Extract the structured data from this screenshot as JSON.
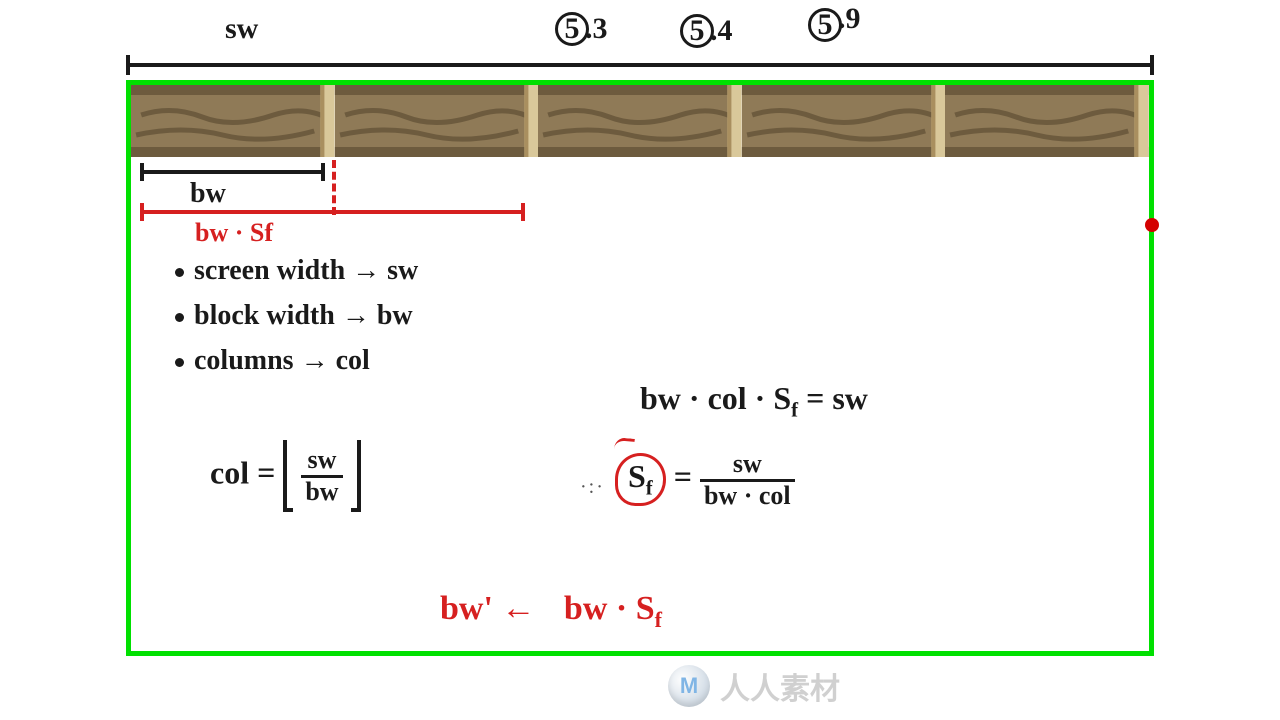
{
  "top": {
    "sw": "sw",
    "v1_prefix": "5",
    "v1_suffix": ".3",
    "v2_prefix": "5",
    "v2_suffix": ".4",
    "v3_prefix": "5",
    "v3_suffix": ".9"
  },
  "labels": {
    "sw_rule": "sw",
    "bw": "bw",
    "bw_sf": "bw · Sf",
    "bullet1": "screen width → sw",
    "bullet2": "block width → bw",
    "bullet3": "columns → col"
  },
  "formulas": {
    "col_eq": "col =",
    "col_num": "sw",
    "col_den": "bw",
    "eq1": "bw · col · S",
    "eq1_sub": "f",
    "eq1_rhs": " = sw",
    "sf_label": "S",
    "sf_sub": "f",
    "sf_eq": " = ",
    "sf_num": "sw",
    "sf_den": "bw · col",
    "bwprime_lhs": "bw'",
    "bwprime_arrow": " ← ",
    "bwprime_rhs": "bw · S",
    "bwprime_sub": "f"
  },
  "watermark": {
    "logo": "M",
    "text": "人人素材"
  },
  "diagram": {
    "tile_count": 5,
    "screen_box_color": "#00e000",
    "handle_color": "#d40000"
  }
}
